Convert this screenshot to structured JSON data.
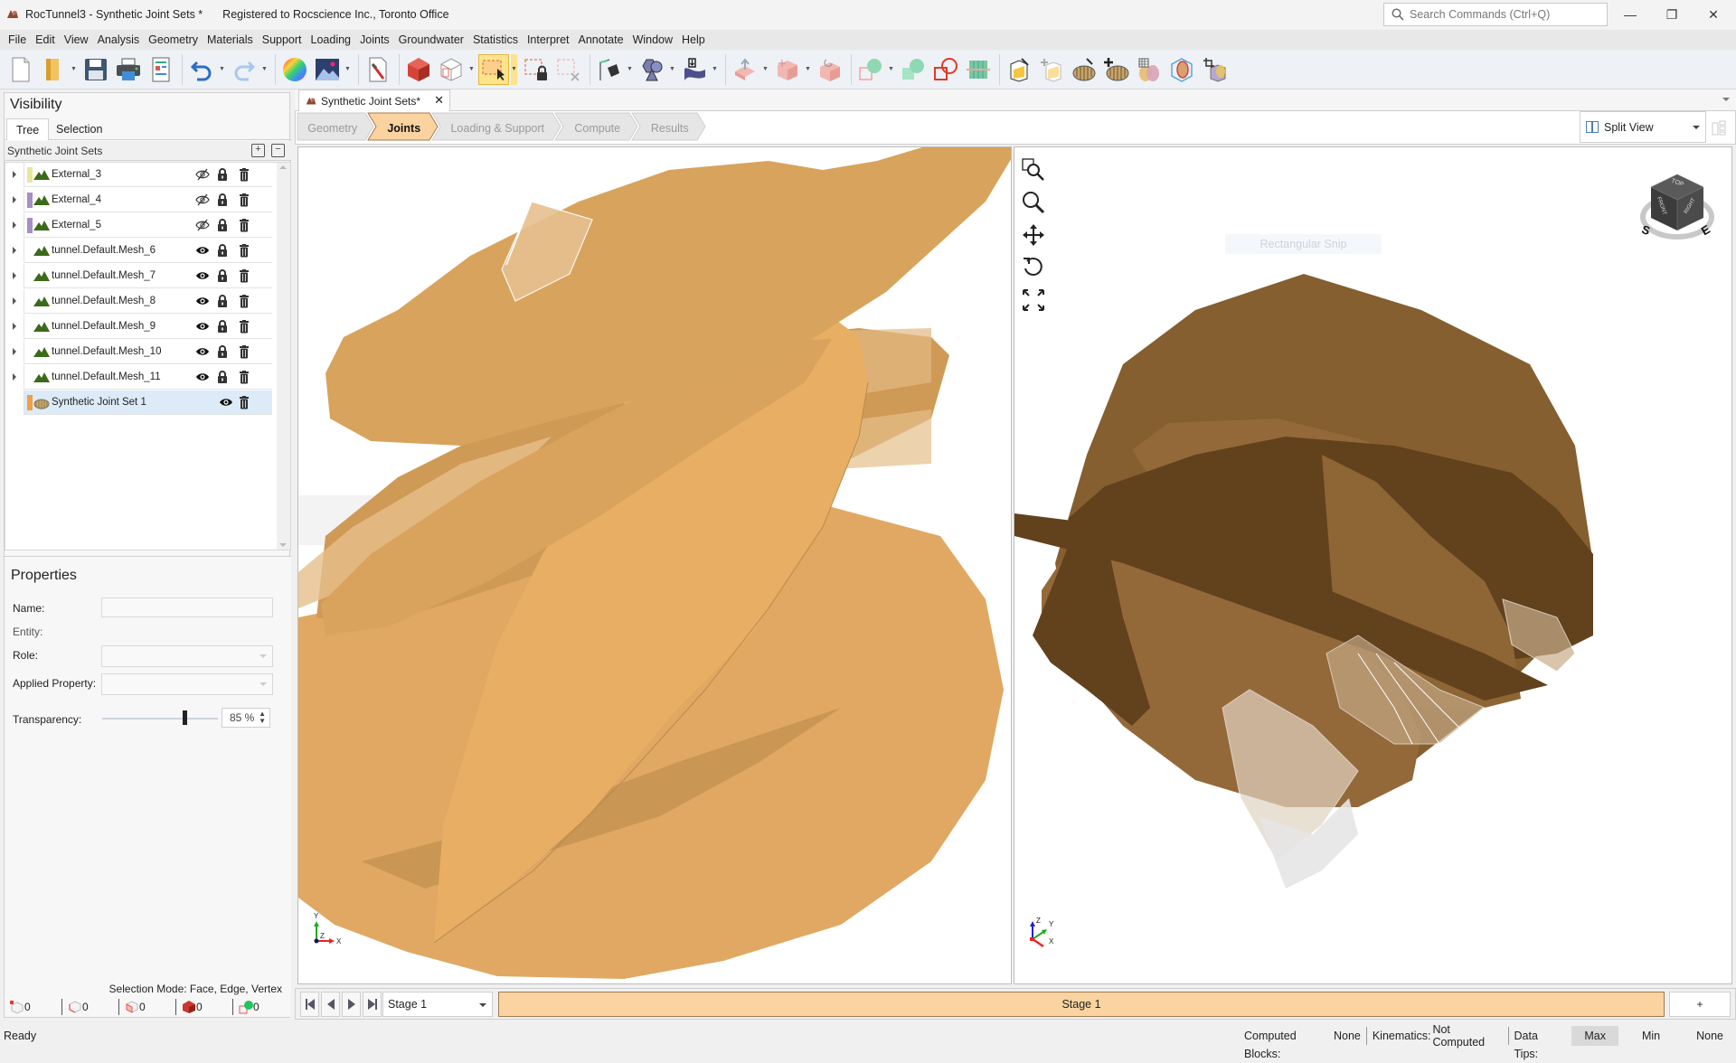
{
  "app": {
    "title": "RocTunnel3 - Synthetic Joint Sets *",
    "registration": "Registered to Rocscience Inc., Toronto Office",
    "search_placeholder": "Search Commands (Ctrl+Q)",
    "window_controls": {
      "minimize": "—",
      "restore": "❐",
      "close": "✕"
    }
  },
  "menu": [
    "File",
    "Edit",
    "View",
    "Analysis",
    "Geometry",
    "Materials",
    "Support",
    "Loading",
    "Joints",
    "Groundwater",
    "Statistics",
    "Interpret",
    "Annotate",
    "Window",
    "Help"
  ],
  "toolbar": {
    "buttons": [
      {
        "name": "new-file-icon"
      },
      {
        "name": "open-folder-icon",
        "dropdown": true
      },
      {
        "name": "save-icon"
      },
      {
        "name": "print-icon"
      },
      {
        "name": "report-icon"
      },
      {
        "name": "undo-icon",
        "dropdown": true
      },
      {
        "name": "redo-icon",
        "dropdown": true
      },
      {
        "name": "color-wheel-icon"
      },
      {
        "name": "image-export-icon",
        "dropdown": true
      },
      {
        "name": "project-settings-icon"
      },
      {
        "name": "solid-block-icon"
      },
      {
        "name": "wireframe-block-icon",
        "dropdown": true
      },
      {
        "name": "rectangle-select-icon",
        "active": true,
        "dropdown": true
      },
      {
        "name": "lock-selection-icon"
      },
      {
        "name": "deselect-icon"
      },
      {
        "name": "polyline-pen-icon",
        "dropdown": true
      },
      {
        "name": "shapes-icon",
        "dropdown": true
      },
      {
        "name": "import-surface-icon",
        "dropdown": true
      },
      {
        "name": "extrude-icon",
        "dropdown": true
      },
      {
        "name": "move-block-icon",
        "dropdown": true
      },
      {
        "name": "rotate-block-icon"
      },
      {
        "name": "boolean-union-icon",
        "dropdown": true
      },
      {
        "name": "boolean-intersect-icon"
      },
      {
        "name": "boolean-difference-icon"
      },
      {
        "name": "grid-icon"
      },
      {
        "name": "edit-joint-icon"
      },
      {
        "name": "add-joint-icon"
      },
      {
        "name": "edit-joint-set-icon"
      },
      {
        "name": "add-joint-set-icon"
      },
      {
        "name": "joint-statistics-icon"
      },
      {
        "name": "joint-box-icon"
      },
      {
        "name": "crop-joint-icon"
      }
    ]
  },
  "visibility": {
    "title": "Visibility",
    "tabs": [
      {
        "label": "Tree",
        "active": true
      },
      {
        "label": "Selection",
        "active": false
      }
    ],
    "tree_header": "Synthetic Joint Sets",
    "items": [
      {
        "label": "External_3",
        "swatch": "#e6e89a",
        "visible": false,
        "lock": true,
        "expandable": true
      },
      {
        "label": "External_4",
        "swatch": "#a78fc6",
        "visible": false,
        "lock": true,
        "expandable": true
      },
      {
        "label": "External_5",
        "swatch": "#a78fc6",
        "visible": false,
        "lock": true,
        "expandable": true
      },
      {
        "label": "tunnel.Default.Mesh_6",
        "swatch": null,
        "visible": true,
        "lock": true,
        "expandable": true
      },
      {
        "label": "tunnel.Default.Mesh_7",
        "swatch": null,
        "visible": true,
        "lock": true,
        "expandable": true
      },
      {
        "label": "tunnel.Default.Mesh_8",
        "swatch": null,
        "visible": true,
        "lock": true,
        "expandable": true
      },
      {
        "label": "tunnel.Default.Mesh_9",
        "swatch": null,
        "visible": true,
        "lock": true,
        "expandable": true
      },
      {
        "label": "tunnel.Default.Mesh_10",
        "swatch": null,
        "visible": true,
        "lock": true,
        "expandable": true
      },
      {
        "label": "tunnel.Default.Mesh_11",
        "swatch": null,
        "visible": true,
        "lock": true,
        "expandable": true
      },
      {
        "label": "Synthetic Joint Set 1",
        "swatch": "#f0a040",
        "visible": true,
        "lock": false,
        "expandable": false,
        "selected": true,
        "joint": true
      }
    ]
  },
  "properties": {
    "title": "Properties",
    "name_label": "Name:",
    "name_value": "",
    "entity_label": "Entity:",
    "role_label": "Role:",
    "applied_property_label": "Applied Property:",
    "transparency_label": "Transparency:",
    "transparency_value": "85 %",
    "transparency_percent": 85
  },
  "selection": {
    "mode_text": "Selection Mode: Face, Edge, Vertex",
    "counters": [
      {
        "name": "vertex-count",
        "value": "0"
      },
      {
        "name": "edge-count",
        "value": "0"
      },
      {
        "name": "face-count",
        "value": "0"
      },
      {
        "name": "block-count",
        "value": "0"
      },
      {
        "name": "joint-count",
        "value": "0"
      }
    ]
  },
  "document": {
    "tab_label": "Synthetic Joint Sets*",
    "workflow": [
      {
        "label": "Geometry",
        "active": false
      },
      {
        "label": "Joints",
        "active": true
      },
      {
        "label": "Loading & Support",
        "active": false
      },
      {
        "label": "Compute",
        "active": false
      },
      {
        "label": "Results",
        "active": false
      }
    ],
    "view_mode": "Split View",
    "snip_overlay": "Rectangular Snip"
  },
  "viewports": {
    "left": {
      "axes": {
        "y": "Y",
        "z": "Z",
        "x": "X"
      },
      "color": "#daa35a"
    },
    "right": {
      "axes": {
        "z": "Z",
        "y": "Y",
        "x": "X"
      },
      "color": "#855f2f",
      "cube": {
        "top": "TOP",
        "front": "FRONT",
        "right": "RIGHT",
        "south": "S",
        "east": "E"
      }
    }
  },
  "stage": {
    "selected": "Stage 1",
    "track_label": "Stage 1",
    "add_label": "+",
    "track_color": "#fad3a0"
  },
  "statusbar": {
    "ready": "Ready",
    "computed_blocks_label": "Computed Blocks:",
    "computed_blocks_value": "None",
    "kinematics_label": "Kinematics:",
    "kinematics_value": "Not Computed",
    "data_tips_label": "Data Tips:",
    "data_tips_options": [
      {
        "label": "Max",
        "active": true
      },
      {
        "label": "Min",
        "active": false
      },
      {
        "label": "None",
        "active": false
      }
    ]
  }
}
